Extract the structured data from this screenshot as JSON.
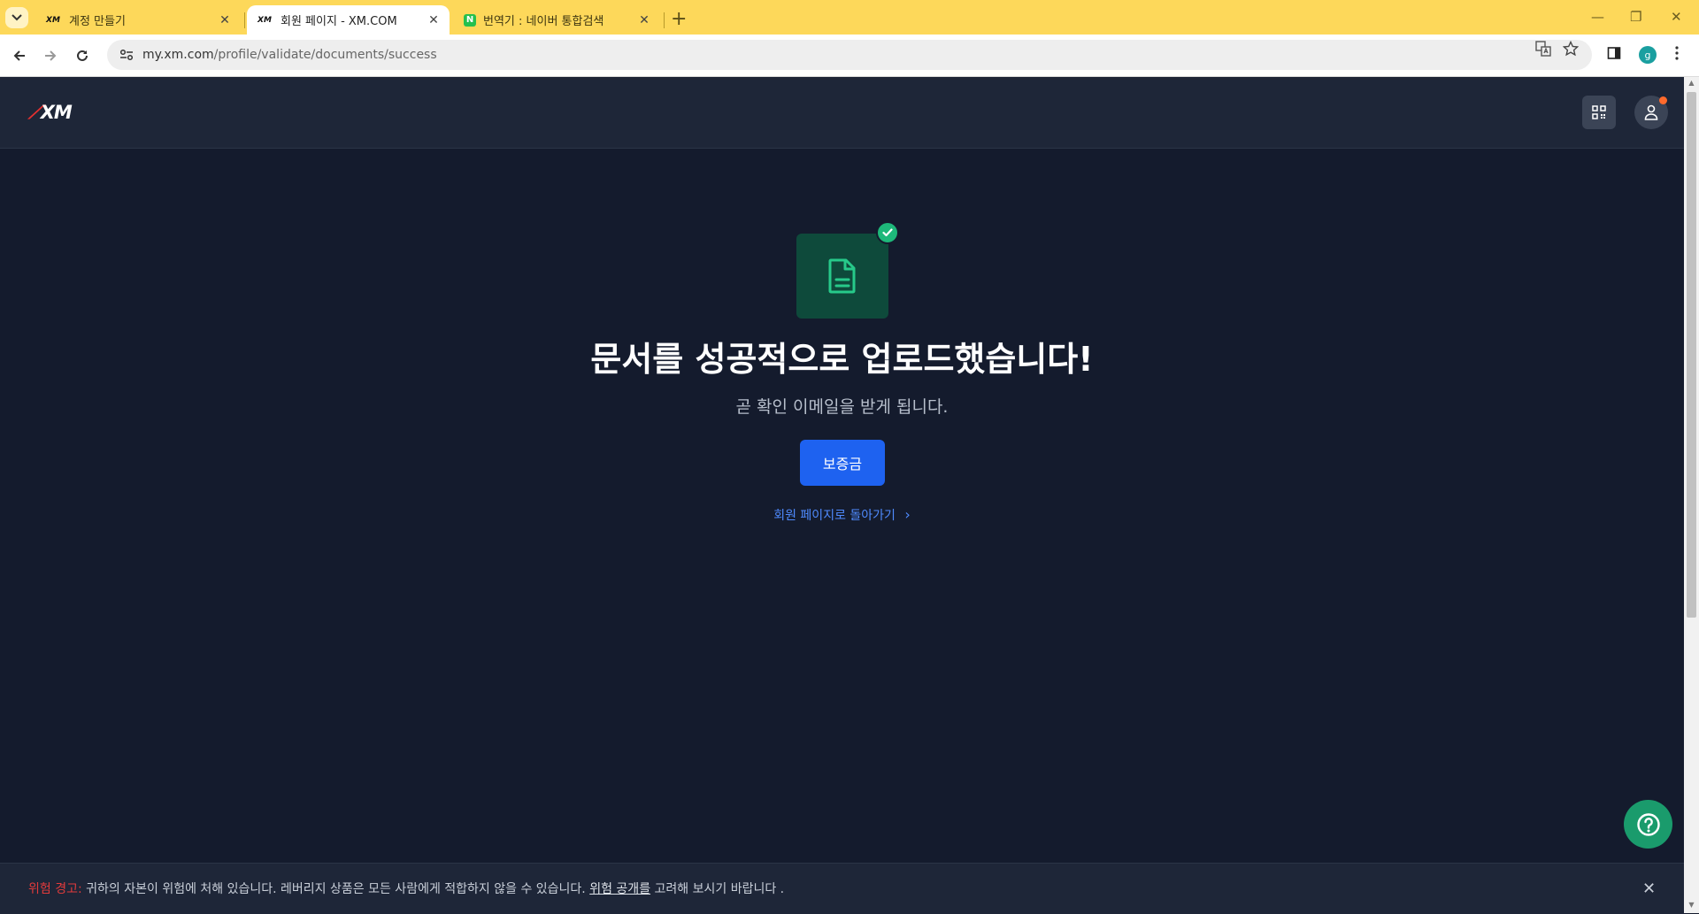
{
  "browser": {
    "tabs": [
      {
        "label": "계정 만들기",
        "favicon": "xm-logo-icon",
        "active": false
      },
      {
        "label": "회원 페이지 - XM.COM",
        "favicon": "xm-logo-icon",
        "active": true
      },
      {
        "label": "번역기 : 네이버 통합검색",
        "favicon": "naver-icon",
        "active": false
      }
    ],
    "favicon_text": "XM",
    "naver_favicon_text": "N",
    "close_glyph": "✕",
    "new_tab_glyph": "+",
    "url_host": "my.xm.com",
    "url_path": "/profile/validate/documents/success",
    "profile_initial": "g",
    "window_controls": [
      "—",
      "❐",
      "✕"
    ]
  },
  "header": {
    "logo_text": "XM",
    "logo_mark": "⟋"
  },
  "main": {
    "headline": "문서를 성공적으로 업로드했습니다!",
    "subline": "곧 확인 이메일을 받게 됩니다.",
    "deposit_button": "보증금",
    "back_link": "회원 페이지로 돌아가기",
    "back_link_arrow": "›"
  },
  "risk_warning": {
    "label": "위험 경고:",
    "text_before": " 귀하의 자본이 위험에 처해 있습니다. 레버리지 상품은 모든 사람에게 적합하지 않을 수 있습니다. ",
    "link": "위험 공개를",
    "text_after": " 고려해 보시기 바랍니다 .",
    "close_glyph": "✕"
  },
  "colors": {
    "tabbar": "#fdd85a",
    "page_bg": "#141b2d",
    "header_bg": "#1e2638",
    "primary_button": "#1e62f0",
    "success": "#1eb87a",
    "warning": "#e23b3b",
    "link": "#4f8bff"
  }
}
